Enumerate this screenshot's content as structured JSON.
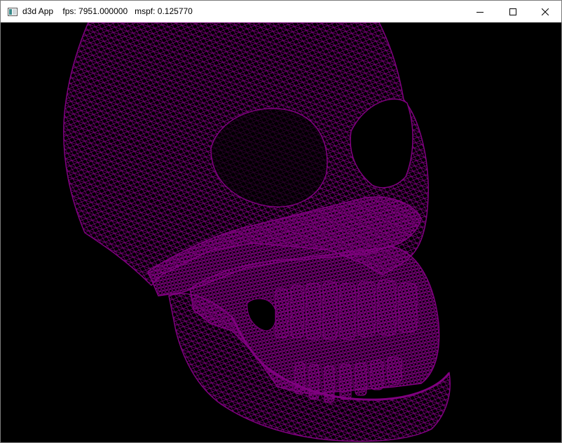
{
  "window": {
    "title": "d3d App    fps: 7951.000000   mspf: 0.125770",
    "controls": [
      "minimize",
      "maximize",
      "close"
    ]
  },
  "render": {
    "background_color": "#000000",
    "wireframe_color": "#800080",
    "model": "skull-wireframe"
  },
  "icons": {
    "app": "app-window-icon",
    "minimize": "minimize-icon",
    "maximize": "maximize-icon",
    "close": "close-icon"
  }
}
